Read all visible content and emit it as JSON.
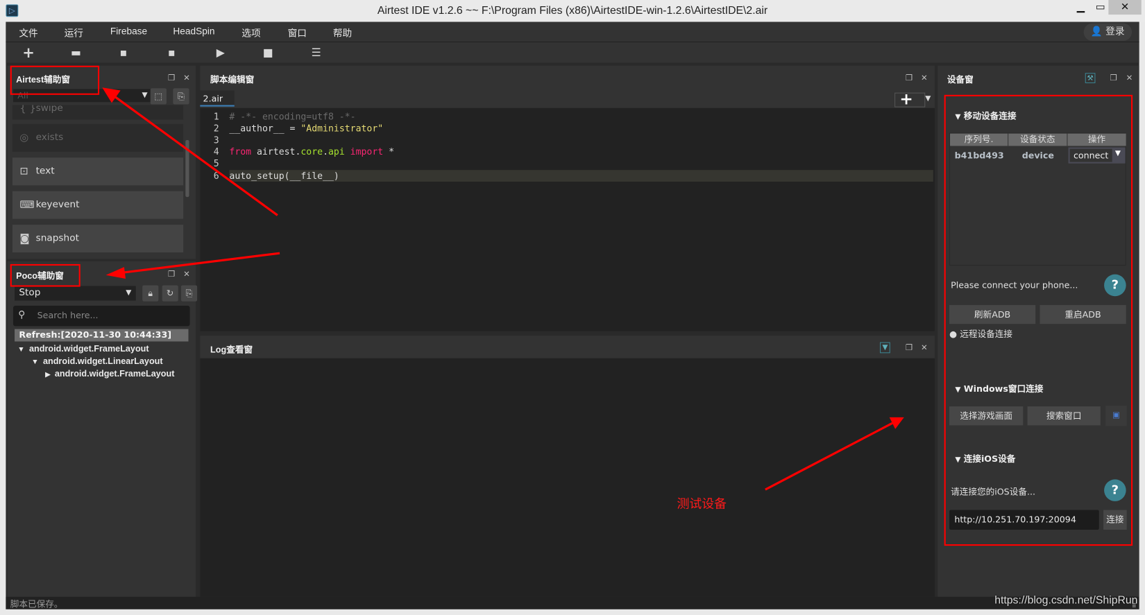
{
  "window": {
    "title": "Airtest IDE v1.2.6 ~~ F:\\Program Files (x86)\\AirtestIDE-win-1.2.6\\AirtestIDE\\2.air",
    "minimize": "▁",
    "maximize": "▭",
    "close": "✕"
  },
  "menu": {
    "items": [
      "文件",
      "运行",
      "Firebase",
      "HeadSpin",
      "选项",
      "窗口",
      "帮助"
    ],
    "login": "登录"
  },
  "toolbar": {
    "icons": [
      "plus-icon",
      "folder-open-icon",
      "save-icon",
      "save-as-icon",
      "play-icon",
      "stop-icon",
      "log-list-icon"
    ]
  },
  "airtest_panel": {
    "title": "Airtest辅助窗",
    "filter_value": "All",
    "items": [
      {
        "label": "swipe",
        "icon": "swipe-icon",
        "enabled": false
      },
      {
        "label": "exists",
        "icon": "exists-icon",
        "enabled": false
      },
      {
        "label": "text",
        "icon": "text-icon",
        "enabled": true
      },
      {
        "label": "keyevent",
        "icon": "keyboard-icon",
        "enabled": true
      },
      {
        "label": "snapshot",
        "icon": "camera-icon",
        "enabled": true
      }
    ]
  },
  "poco_panel": {
    "title": "Poco辅助窗",
    "mode_value": "Stop",
    "search_placeholder": "Search here...",
    "refresh": "Refresh:[2020-11-30 10:44:33]",
    "tree": [
      {
        "label": "android.widget.FrameLayout",
        "level": 0,
        "expanded": true
      },
      {
        "label": "android.widget.LinearLayout",
        "level": 1,
        "expanded": true
      },
      {
        "label": "android.widget.FrameLayout",
        "level": 2,
        "expanded": false
      }
    ]
  },
  "editor": {
    "title": "脚本编辑窗",
    "tab": "2.air",
    "lines": [
      {
        "n": "1",
        "text": "# -*- encoding=utf8 -*-"
      },
      {
        "n": "2",
        "text": "__author__ = \"Administrator\""
      },
      {
        "n": "3",
        "text": ""
      },
      {
        "n": "4",
        "text": "from airtest.core.api import *"
      },
      {
        "n": "5",
        "text": ""
      },
      {
        "n": "6",
        "text": "auto_setup(__file__)"
      }
    ]
  },
  "log_panel": {
    "title": "Log查看窗"
  },
  "device_panel": {
    "title": "设备窗",
    "mobile_section": "移动设备连接",
    "table_headers": [
      "序列号.",
      "设备状态",
      "操作"
    ],
    "devices": [
      {
        "serial": "b41bd493",
        "status": "device",
        "action": "connect"
      }
    ],
    "connect_hint": "Please connect your phone...",
    "refresh_adb": "刷新ADB",
    "restart_adb": "重启ADB",
    "remote_connect": "远程设备连接",
    "windows_section": "Windows窗口连接",
    "select_game": "选择游戏画面",
    "search_window": "搜索窗口",
    "ios_section": "连接iOS设备",
    "ios_hint": "请连接您的iOS设备...",
    "ios_url": "http://10.251.70.197:20094",
    "ios_connect": "连接"
  },
  "status_bar": {
    "message": "脚本已保存。"
  },
  "annotations": {
    "label": "测试设备",
    "watermark": "https://blog.csdn.net/ShipRun",
    "color": "#ff0000"
  }
}
